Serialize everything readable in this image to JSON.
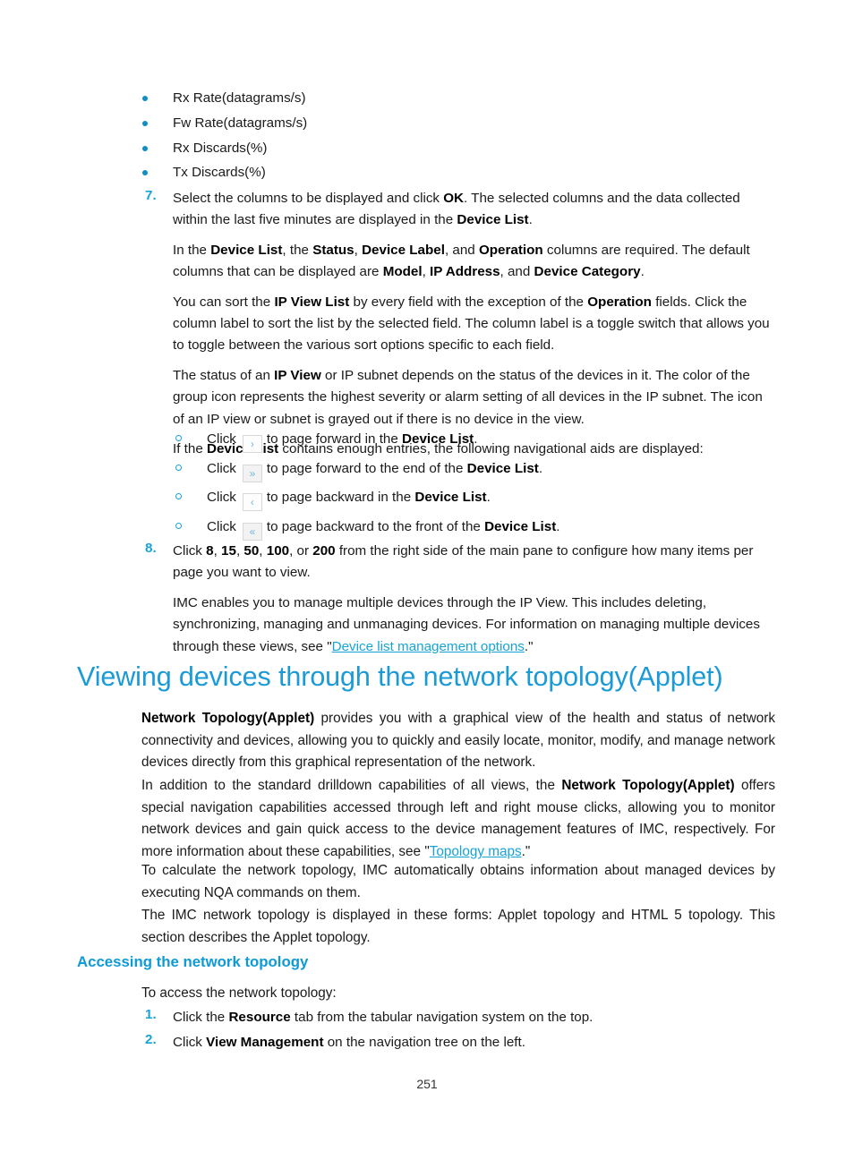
{
  "document": {
    "page_number": "251"
  },
  "colors": {
    "heading_blue": "#1a9ad7",
    "subheading_blue": "#0e9ad9",
    "bullet_blue": "#0e8fc4",
    "link_blue": "#18a3d8",
    "body_text": "#1a1a1a"
  },
  "bullet_list": {
    "items": [
      "Rx Rate(datagrams/s)",
      "Fw Rate(datagrams/s)",
      "Rx Discards(%)",
      "Tx Discards(%)"
    ]
  },
  "step7": {
    "number": "7.",
    "p1": {
      "a": "Select the columns to be displayed and click ",
      "b1": "OK",
      "b": ". The selected columns and the data collected within the last five minutes are displayed in the ",
      "b2": "Device List",
      "c": "."
    },
    "p2": {
      "a": "In the ",
      "b1": "Device List",
      "b": ", the ",
      "b2": "Status",
      "c": ", ",
      "b3": "Device Label",
      "d": ", and ",
      "b4": "Operation",
      "e": " columns are required. The default columns that can be displayed are ",
      "b5": "Model",
      "f": ", ",
      "b6": "IP Address",
      "g": ", and ",
      "b7": "Device Category",
      "h": "."
    },
    "p3": {
      "a": "You can sort the ",
      "b1": "IP View List",
      "b": " by every field with the exception of the ",
      "b2": "Operation",
      "c": " fields. Click the column label to sort the list by the selected field. The column label is a toggle switch that allows you to toggle between the various sort options specific to each field."
    },
    "p4": {
      "a": "The status of an ",
      "b1": "IP View",
      "b": " or IP subnet depends on the status of the devices in it. The color of the group icon represents the highest severity or alarm setting of all devices in the IP subnet. The icon of an IP view or subnet is grayed out if there is no device in the view."
    },
    "p5": {
      "a": "If the ",
      "b1": "Device List",
      "b": " contains enough entries, the following navigational aids are displayed:"
    }
  },
  "nav_aids": {
    "items": [
      {
        "click_label": "Click",
        "icon": "chevron-right-icon",
        "glyph": "›",
        "shaded": false,
        "text_before": "to page forward in the ",
        "bold": "Device List",
        "text_after": "."
      },
      {
        "click_label": "Click",
        "icon": "chevron-double-right-icon",
        "glyph": "»",
        "shaded": true,
        "text_before": "to page forward to the end of the ",
        "bold": "Device List",
        "text_after": "."
      },
      {
        "click_label": "Click",
        "icon": "chevron-left-icon",
        "glyph": "‹",
        "shaded": false,
        "text_before": "to page backward in the ",
        "bold": "Device List",
        "text_after": "."
      },
      {
        "click_label": "Click",
        "icon": "chevron-double-left-icon",
        "glyph": "«",
        "shaded": true,
        "text_before": "to page backward to the front of the ",
        "bold": "Device List",
        "text_after": "."
      }
    ]
  },
  "step8": {
    "number": "8.",
    "p1": {
      "a": "Click ",
      "b1": "8",
      "b": ", ",
      "b2": "15",
      "c": ", ",
      "b3": "50",
      "d": ", ",
      "b4": "100",
      "e": ", or ",
      "b5": "200",
      "f": " from the right side of the main pane to configure how many items per page you want to view."
    },
    "p2": {
      "a": "IMC enables you to manage multiple devices through the IP View. This includes deleting, synchronizing, managing and unmanaging devices. For information on managing multiple devices through these views, see \"",
      "link": "Device list management options",
      "b": ".\""
    }
  },
  "section": {
    "heading": "Viewing devices through the network topology(Applet)",
    "p1": {
      "b1": "Network Topology(Applet)",
      "a": " provides you with a graphical view of the health and status of network connectivity and devices, allowing you to quickly and easily locate, monitor, modify, and manage network devices directly from this graphical representation of the network."
    },
    "p2": {
      "a": "In addition to the standard drilldown capabilities of all views, the ",
      "b1": "Network Topology(Applet)",
      "b": " offers special navigation capabilities accessed through left and right mouse clicks, allowing you to monitor network devices and gain quick access to the device management features of IMC, respectively. For more information about these capabilities, see \"",
      "link": "Topology maps",
      "c": ".\""
    },
    "p3": "To calculate the network topology, IMC automatically obtains information about managed devices by executing NQA commands on them.",
    "p4": "The IMC network topology is displayed in these forms: Applet topology and HTML 5 topology. This section describes the Applet topology."
  },
  "subsection": {
    "heading": "Accessing the network topology",
    "intro": "To access the network topology:",
    "steps": [
      {
        "number": "1.",
        "a": "Click the ",
        "b1": "Resource",
        "b": " tab from the tabular navigation system on the top."
      },
      {
        "number": "2.",
        "a": "Click ",
        "b1": "View Management",
        "b": " on the navigation tree on the left."
      }
    ]
  }
}
